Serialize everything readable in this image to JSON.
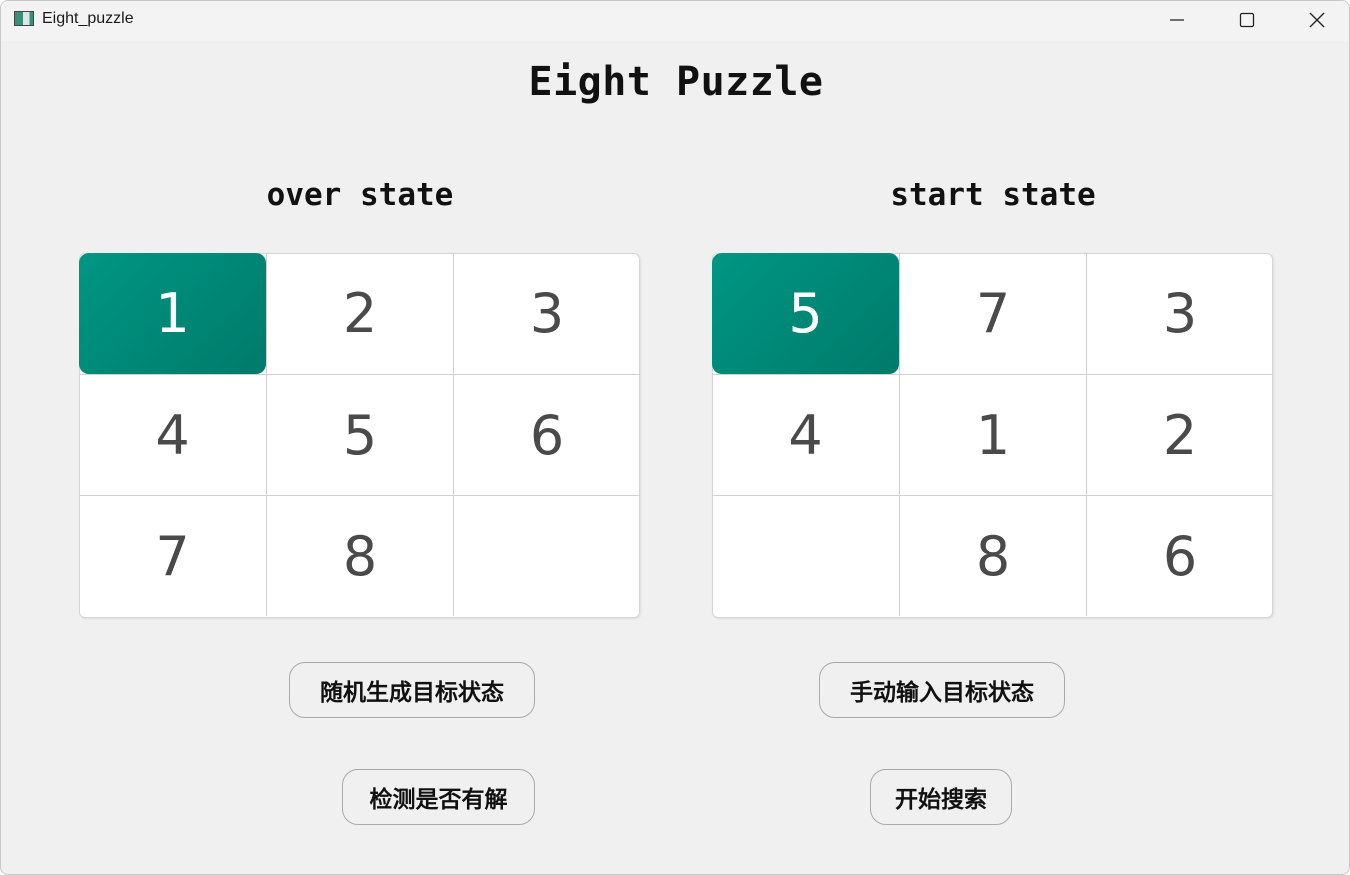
{
  "window": {
    "title": "Eight_puzzle"
  },
  "main_title": "Eight Puzzle",
  "over_state": {
    "title": "over state",
    "cells": [
      "1",
      "2",
      "3",
      "4",
      "5",
      "6",
      "7",
      "8",
      ""
    ],
    "selected_index": 0
  },
  "start_state": {
    "title": "start state",
    "cells": [
      "5",
      "7",
      "3",
      "4",
      "1",
      "2",
      "",
      "8",
      "6"
    ],
    "selected_index": 0
  },
  "buttons": {
    "random_target": "随机生成目标状态",
    "manual_target": "手动输入目标状态",
    "check_solvable": "检测是否有解",
    "start_search": "开始搜索"
  },
  "colors": {
    "selected_tile": "#00897b",
    "window_bg": "#f0f0f0"
  },
  "icons": {
    "app": "app-icon",
    "minimize": "minimize-icon",
    "maximize": "maximize-icon",
    "close": "close-icon"
  }
}
